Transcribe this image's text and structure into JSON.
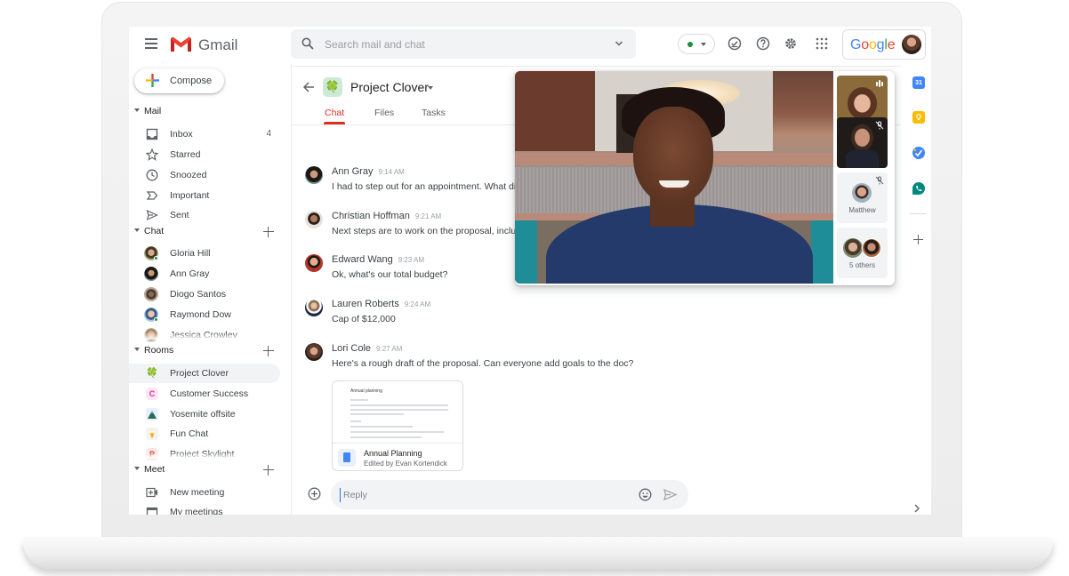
{
  "header": {
    "app_name": "Gmail",
    "search_placeholder": "Search mail and chat",
    "status_color": "#1e8e3e",
    "google_label": [
      "G",
      "o",
      "o",
      "g",
      "l",
      "e"
    ],
    "google_colors": [
      "#4285f4",
      "#ea4335",
      "#fbbc05",
      "#4285f4",
      "#34a853",
      "#ea4335"
    ],
    "icons": [
      "status-dropdown-icon",
      "tasks-check-icon",
      "help-icon",
      "settings-gear-icon",
      "apps-grid-icon"
    ]
  },
  "sidebar": {
    "compose_label": "Compose",
    "mail": {
      "title": "Mail",
      "items": [
        {
          "label": "Inbox",
          "count": "4",
          "icon": "inbox-icon"
        },
        {
          "label": "Starred",
          "icon": "star-icon"
        },
        {
          "label": "Snoozed",
          "icon": "clock-icon"
        },
        {
          "label": "Important",
          "icon": "important-icon"
        },
        {
          "label": "Sent",
          "icon": "send-icon"
        }
      ]
    },
    "chat": {
      "title": "Chat",
      "items": [
        {
          "label": "Gloria Hill",
          "online": true
        },
        {
          "label": "Ann Gray",
          "online": false
        },
        {
          "label": "Diogo Santos",
          "online": false
        },
        {
          "label": "Raymond Dow",
          "online": true
        },
        {
          "label": "Jessica Crowley",
          "online": false
        }
      ]
    },
    "rooms": {
      "title": "Rooms",
      "items": [
        {
          "label": "Project Clover",
          "icon": "🍀",
          "selected": true
        },
        {
          "label": "Customer Success",
          "letter": "C",
          "color": "#e52592",
          "bg": "#fde7f3"
        },
        {
          "label": "Yosemite offsite",
          "icon": "⛰"
        },
        {
          "label": "Fun Chat",
          "icon": "🍦"
        },
        {
          "label": "Project Skylight",
          "letter": "P",
          "color": "#d93025",
          "bg": "#fce8e6"
        }
      ]
    },
    "meet": {
      "title": "Meet",
      "items": [
        {
          "label": "New meeting",
          "icon": "video-add-icon"
        },
        {
          "label": "My meetings",
          "icon": "calendar-icon"
        }
      ]
    }
  },
  "room": {
    "title": "Project Clover",
    "icon": "🍀",
    "tabs": [
      {
        "label": "Chat",
        "active": true
      },
      {
        "label": "Files",
        "active": false
      },
      {
        "label": "Tasks",
        "active": false
      }
    ],
    "messages": [
      {
        "name": "Ann Gray",
        "time": "9:14 AM",
        "text": "I had to step out for an appointment. What did"
      },
      {
        "name": "Christian Hoffman",
        "time": "9:21 AM",
        "text": "Next steps are to work on the proposal, includ"
      },
      {
        "name": "Edward Wang",
        "time": "9:23 AM",
        "text": "Ok, what's our total budget?"
      },
      {
        "name": "Lauren Roberts",
        "time": "9:24 AM",
        "text": "Cap of $12,000"
      },
      {
        "name": "Lori Cole",
        "time": "9:27 AM",
        "text": "Here's a rough draft of the proposal. Can everyone add goals to the doc?"
      }
    ],
    "attachment": {
      "preview_title": "Annual planning",
      "title": "Annual Planning",
      "subtitle": "Edited by Evan Kortendick"
    },
    "reply_placeholder": "Reply"
  },
  "call": {
    "participants": [
      {
        "name": "",
        "muted": false,
        "speaking": true
      },
      {
        "name": "",
        "muted": true
      },
      {
        "name": "Matthew",
        "muted": true
      },
      {
        "name": "5 others",
        "muted": false
      }
    ]
  },
  "rail": {
    "apps": [
      {
        "name": "calendar",
        "label": "31",
        "color": "#4285f4"
      },
      {
        "name": "keep",
        "color": "#fbbc04"
      },
      {
        "name": "tasks",
        "color": "#4285f4"
      },
      {
        "name": "hangouts-phone",
        "color": "#00897b"
      }
    ]
  }
}
